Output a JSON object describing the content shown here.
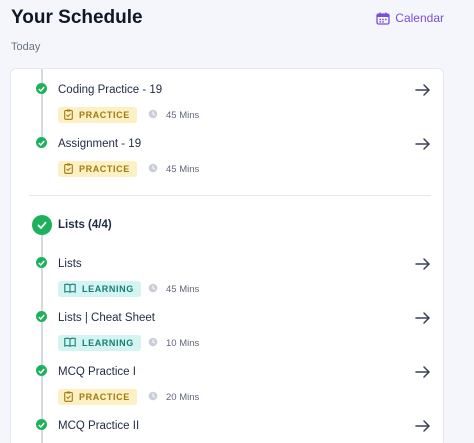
{
  "header": {
    "title": "Your Schedule",
    "calendar_label": "Calendar",
    "subtitle": "Today"
  },
  "colors": {
    "accent": "#7b4fd8",
    "done": "#1eb15c",
    "practice_bg": "#fdf0c4",
    "learning_bg": "#d3f4f1"
  },
  "items": [
    {
      "title": "Coding Practice - 19",
      "badge": "PRACTICE",
      "duration": "45 Mins"
    },
    {
      "title": "Assignment - 19",
      "badge": "PRACTICE",
      "duration": "45 Mins"
    }
  ],
  "section": {
    "title": "Lists (4/4)",
    "items": [
      {
        "title": "Lists",
        "badge": "LEARNING",
        "duration": "45 Mins"
      },
      {
        "title": "Lists | Cheat Sheet",
        "badge": "LEARNING",
        "duration": "10 Mins"
      },
      {
        "title": "MCQ Practice I",
        "badge": "PRACTICE",
        "duration": "20 Mins"
      },
      {
        "title": "MCQ Practice II"
      }
    ]
  }
}
